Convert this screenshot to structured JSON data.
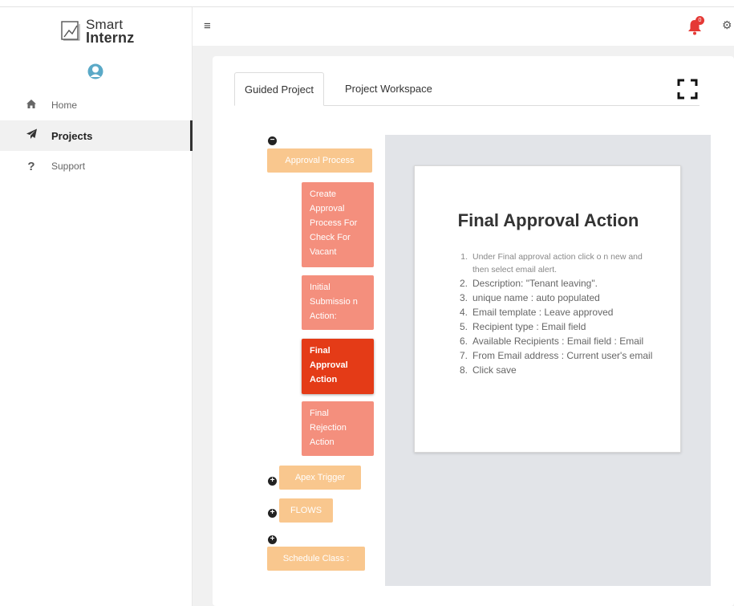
{
  "brand": {
    "line1": "Smart",
    "line2": "Internz"
  },
  "sidebar": {
    "items": [
      {
        "label": "Home",
        "icon": "home-icon"
      },
      {
        "label": "Projects",
        "icon": "paper-plane-icon",
        "active": true
      },
      {
        "label": "Support",
        "icon": "question-icon"
      }
    ]
  },
  "header": {
    "menu_icon": "hamburger-icon",
    "notification_badge": "0"
  },
  "tabs": [
    {
      "label": "Guided Project",
      "active": true
    },
    {
      "label": "Project Workspace",
      "active": false
    }
  ],
  "tree": {
    "approval": {
      "toggle": "−",
      "label": "Approval Process",
      "children": [
        {
          "label": "Create Approval Process For Check For Vacant"
        },
        {
          "label": "Initial Submissio n Action:"
        },
        {
          "label": "Final Approval Action",
          "active": true
        },
        {
          "label": "Final Rejection Action"
        }
      ]
    },
    "apex": {
      "toggle": "+",
      "label": "Apex Trigger"
    },
    "flows": {
      "toggle": "+",
      "label": "FLOWS"
    },
    "schedule": {
      "toggle": "+",
      "label": "Schedule Class :"
    }
  },
  "detail": {
    "title": "Final Approval Action",
    "steps": [
      {
        "n": "1.",
        "text": "Under Final approval action click o n new and then select email alert."
      },
      {
        "n": "2.",
        "text": "Description: \"Tenant leaving\"."
      },
      {
        "n": "3.",
        "text": "unique name : auto populated"
      },
      {
        "n": "4.",
        "text": "Email template : Leave approved"
      },
      {
        "n": "5.",
        "text": "Recipient type : Email field"
      },
      {
        "n": "6.",
        "text": "Available Recipients : Email field : Email"
      },
      {
        "n": "7.",
        "text": "From Email address : Current user's email"
      },
      {
        "n": "8.",
        "text": "Click save"
      }
    ]
  },
  "colors": {
    "node_top": "#f9c78e",
    "node_sub": "#f48f7d",
    "node_active": "#e43b17",
    "panel_bg": "#e2e4e8"
  }
}
